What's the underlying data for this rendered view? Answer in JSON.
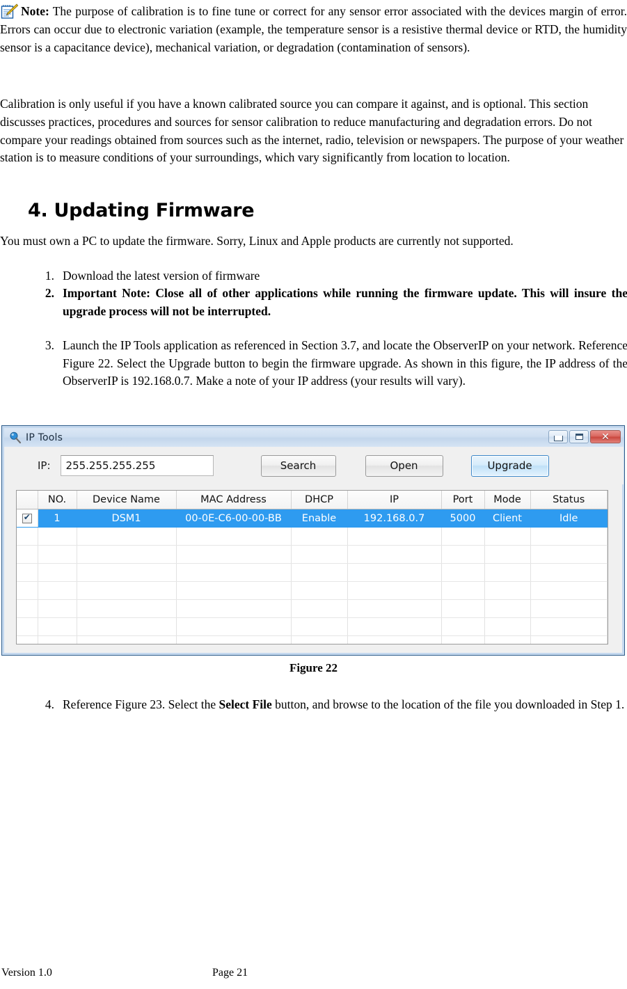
{
  "note": {
    "icon": "notepad-pencil-icon",
    "label": "Note:",
    "text": " The purpose of calibration is to fine tune or correct for any sensor error associated with the devices margin of error. Errors can occur due to electronic variation (example, the temperature sensor is a resistive thermal device or RTD, the humidity sensor is a capacitance device), mechanical variation, or degradation (contamination of sensors)."
  },
  "calibration_paragraph": "Calibration is only useful if you have a known calibrated source you can compare it against, and is optional. This section discusses practices, procedures and sources for sensor calibration to reduce manufacturing and degradation errors. Do not compare your readings obtained from sources such as the internet, radio, television or newspapers. The purpose of your weather station is to measure conditions of your surroundings, which vary significantly from location to location.",
  "section": {
    "heading": "4. Updating Firmware",
    "intro": "You must own a PC to update the firmware. Sorry, Linux and Apple products are currently not supported."
  },
  "steps": [
    {
      "num": "1.",
      "text": "Download the latest version of firmware"
    },
    {
      "num": "2.",
      "text": "Important Note: Close all of other applications while running the firmware update. This will insure the upgrade process will not be interrupted."
    },
    {
      "num": "3.",
      "text": "Launch the IP Tools application as referenced in Section 3.7, and locate the ObserverIP on your network. Reference Figure 22. Select the Upgrade button to begin the firmware upgrade. As shown in this figure, the IP address of the ObserverIP is 192.168.0.7. Make a note of your IP address (your results will vary)."
    },
    {
      "num": "4.",
      "prefix": "Reference Figure 23.    Select the ",
      "emphasis": "Select File",
      "suffix": " button, and browse to the location of the file you downloaded in Step 1."
    }
  ],
  "figure22": {
    "caption": "Figure 22",
    "window": {
      "title": "IP Tools",
      "title_icon": "magnifier-icon",
      "controls": {
        "minimize": "minimize-icon",
        "maximize": "maximize-icon",
        "close": "✕"
      },
      "toolbar": {
        "ip_label": "IP:",
        "ip_value": "255.255.255.255",
        "ip_placeholder": "255.255.255.255",
        "search_label": "Search",
        "open_label": "Open",
        "upgrade_label": "Upgrade"
      },
      "table": {
        "columns": [
          "NO.",
          "Device Name",
          "MAC Address",
          "DHCP",
          "IP",
          "Port",
          "Mode",
          "Status"
        ],
        "rows": [
          {
            "checked": true,
            "no": "1",
            "device_name": "DSM1",
            "mac_address": "00-0E-C6-00-00-BB",
            "dhcp": "Enable",
            "ip": "192.168.0.7",
            "port": "5000",
            "mode": "Client",
            "status": "Idle"
          }
        ],
        "empty_row_count": 8,
        "selected_row_color": "#2e9bf0"
      }
    }
  },
  "footer": {
    "version": "Version 1.0",
    "page": "Page 21"
  }
}
